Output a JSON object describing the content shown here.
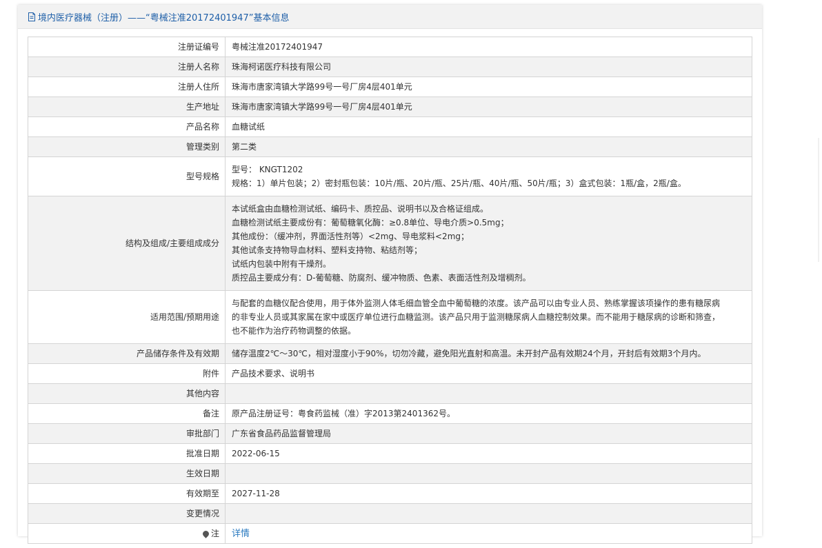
{
  "header": {
    "title": "境内医疗器械（注册）——“粤械注准20172401947”基本信息",
    "accent_color": "#1e5fa8",
    "icon": "document-icon"
  },
  "rows": [
    {
      "label": "注册证编号",
      "value": [
        "粤械注准20172401947"
      ]
    },
    {
      "label": "注册人名称",
      "value": [
        "珠海柯诺医疗科技有限公司"
      ]
    },
    {
      "label": "注册人住所",
      "value": [
        "珠海市唐家湾镇大学路99号一号厂房4层401单元"
      ]
    },
    {
      "label": "生产地址",
      "value": [
        "珠海市唐家湾镇大学路99号一号厂房4层401单元"
      ]
    },
    {
      "label": "产品名称",
      "value": [
        "血糖试纸"
      ]
    },
    {
      "label": "管理类别",
      "value": [
        "第二类"
      ]
    },
    {
      "label": "型号规格",
      "value": [
        "型号： KNGT1202",
        "规格：1）单片包装；2）密封瓶包装：10片/瓶、20片/瓶、25片/瓶、40片/瓶、50片/瓶；3）盒式包装：1瓶/盒，2瓶/盒。"
      ]
    },
    {
      "label": "结构及组成/主要组成成分",
      "value": [
        "本试纸盒由血糖检测试纸、编码卡、质控品、说明书以及合格证组成。",
        "血糖检测试纸主要成份有：葡萄糖氧化酶：≥0.8单位、导电介质>0.5mg；",
        "其他成份：（缓冲剂，界面活性剂等）<2mg、导电浆料<2mg；",
        "其他试条支持物导血材料、塑料支持物、粘结剂等；",
        "试纸内包装中附有干燥剂。",
        "质控品主要成分有：D-葡萄糖、防腐剂、缓冲物质、色素、表面活性剂及增稠剂。"
      ]
    },
    {
      "label": "适用范围/预期用途",
      "value": [
        "与配套的血糖仪配合使用，用于体外监测人体毛细血管全血中葡萄糖的浓度。该产品可以由专业人员、熟练掌握该项操作的患有糖尿病",
        "的非专业人员或其家属在家中或医疗单位进行血糖监测。该产品只用于监测糖尿病人血糖控制效果。而不能用于糖尿病的诊断和筛查，",
        "也不能作为治疗药物调整的依据。"
      ]
    },
    {
      "label": "产品储存条件及有效期",
      "value": [
        "储存温度2℃～30℃，相对湿度小于90%，切勿冷藏，避免阳光直射和高温。未开封产品有效期24个月，开封后有效期3个月内。"
      ]
    },
    {
      "label": "附件",
      "value": [
        "产品技术要求、说明书"
      ]
    },
    {
      "label": "其他内容",
      "value": [
        ""
      ]
    },
    {
      "label": "备注",
      "value": [
        "原产品注册证号：粤食药监械（准）字2013第2401362号。"
      ]
    },
    {
      "label": "审批部门",
      "value": [
        "广东省食品药品监督管理局"
      ]
    },
    {
      "label": "批准日期",
      "value": [
        "2022-06-15"
      ]
    },
    {
      "label": "生效日期",
      "value": [
        ""
      ]
    },
    {
      "label": "有效期至",
      "value": [
        "2027-11-28"
      ]
    },
    {
      "label": "变更情况",
      "value": [
        ""
      ]
    }
  ],
  "note_row": {
    "label": "注",
    "icon": "location-pin-icon",
    "link_label": "详情"
  }
}
